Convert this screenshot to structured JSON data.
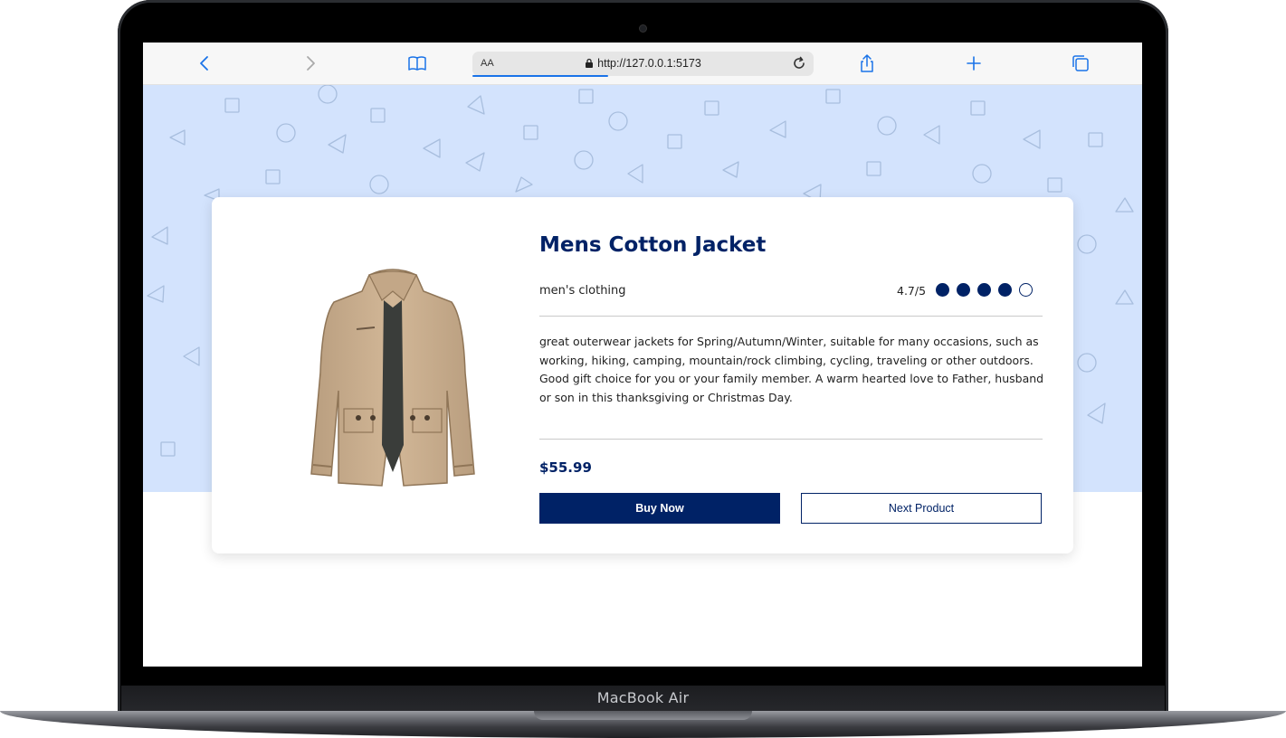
{
  "device": {
    "label": "MacBook Air"
  },
  "browser": {
    "text_size_label": "AA",
    "url": "http://127.0.0.1:5173",
    "icons": [
      "back-icon",
      "forward-icon",
      "bookmarks-icon",
      "lock-icon",
      "reload-icon",
      "share-icon",
      "new-tab-icon",
      "tabs-icon"
    ]
  },
  "product": {
    "title": "Mens Cotton Jacket",
    "category": "men's clothing",
    "rating_text": "4.7/5",
    "rating_filled": 4,
    "rating_max": 5,
    "description": "great outerwear jackets for Spring/Autumn/Winter, suitable for many occasions, such as working, hiking, camping, mountain/rock climbing, cycling, traveling or other outdoors. Good gift choice for you or your family member. A warm hearted love to Father, husband or son in this thanksgiving or Christmas Day.",
    "price": "$55.99",
    "buy_label": "Buy Now",
    "next_label": "Next Product"
  },
  "colors": {
    "accent": "#002266",
    "hero_bg": "#d3e3fd",
    "browser_blue": "#1a73e8"
  }
}
